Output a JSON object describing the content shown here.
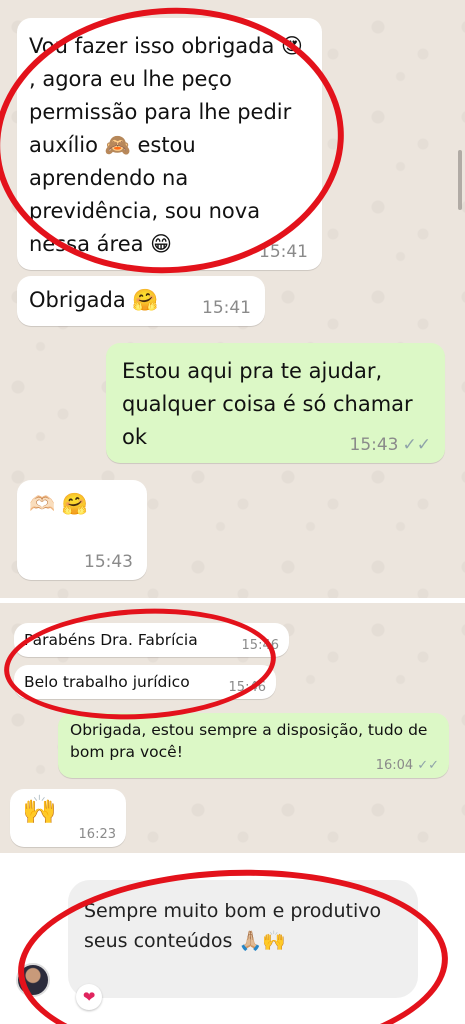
{
  "panel1": {
    "messages": [
      {
        "text": "Vou fazer isso  obrigada 😍 ,  agora eu lhe peço permissão para lhe pedir auxílio 🙈 estou aprendendo na previdência, sou nova nessa área 😁",
        "time": "15:41"
      },
      {
        "text": "Obrigada 🤗",
        "time": "15:41"
      },
      {
        "text": "Estou aqui pra te ajudar, qualquer coisa é só chamar ok",
        "time": "15:43",
        "ticks": "✓✓"
      },
      {
        "text": "🫶🏻 🤗",
        "time": "15:43"
      }
    ]
  },
  "panel2": {
    "messages": [
      {
        "text": "Parabéns Dra. Fabrícia",
        "time": "15:46"
      },
      {
        "text": "Belo trabalho jurídico",
        "time": "15:46"
      },
      {
        "text": "Obrigada, estou sempre a disposição, tudo de bom pra você!",
        "time": "16:04",
        "ticks": "✓✓"
      },
      {
        "text": "🙌",
        "time": "16:23"
      }
    ]
  },
  "panel3": {
    "comment": {
      "text": "Sempre muito bom e produtivo seus conteúdos 🙏🏼🙌",
      "reaction": "❤"
    }
  },
  "colors": {
    "chat_bg": "#ECE5DD",
    "incoming": "#ffffff",
    "outgoing": "#DCF8C6",
    "highlight": "#e3121b",
    "comment_bg": "#EFEFEF"
  }
}
